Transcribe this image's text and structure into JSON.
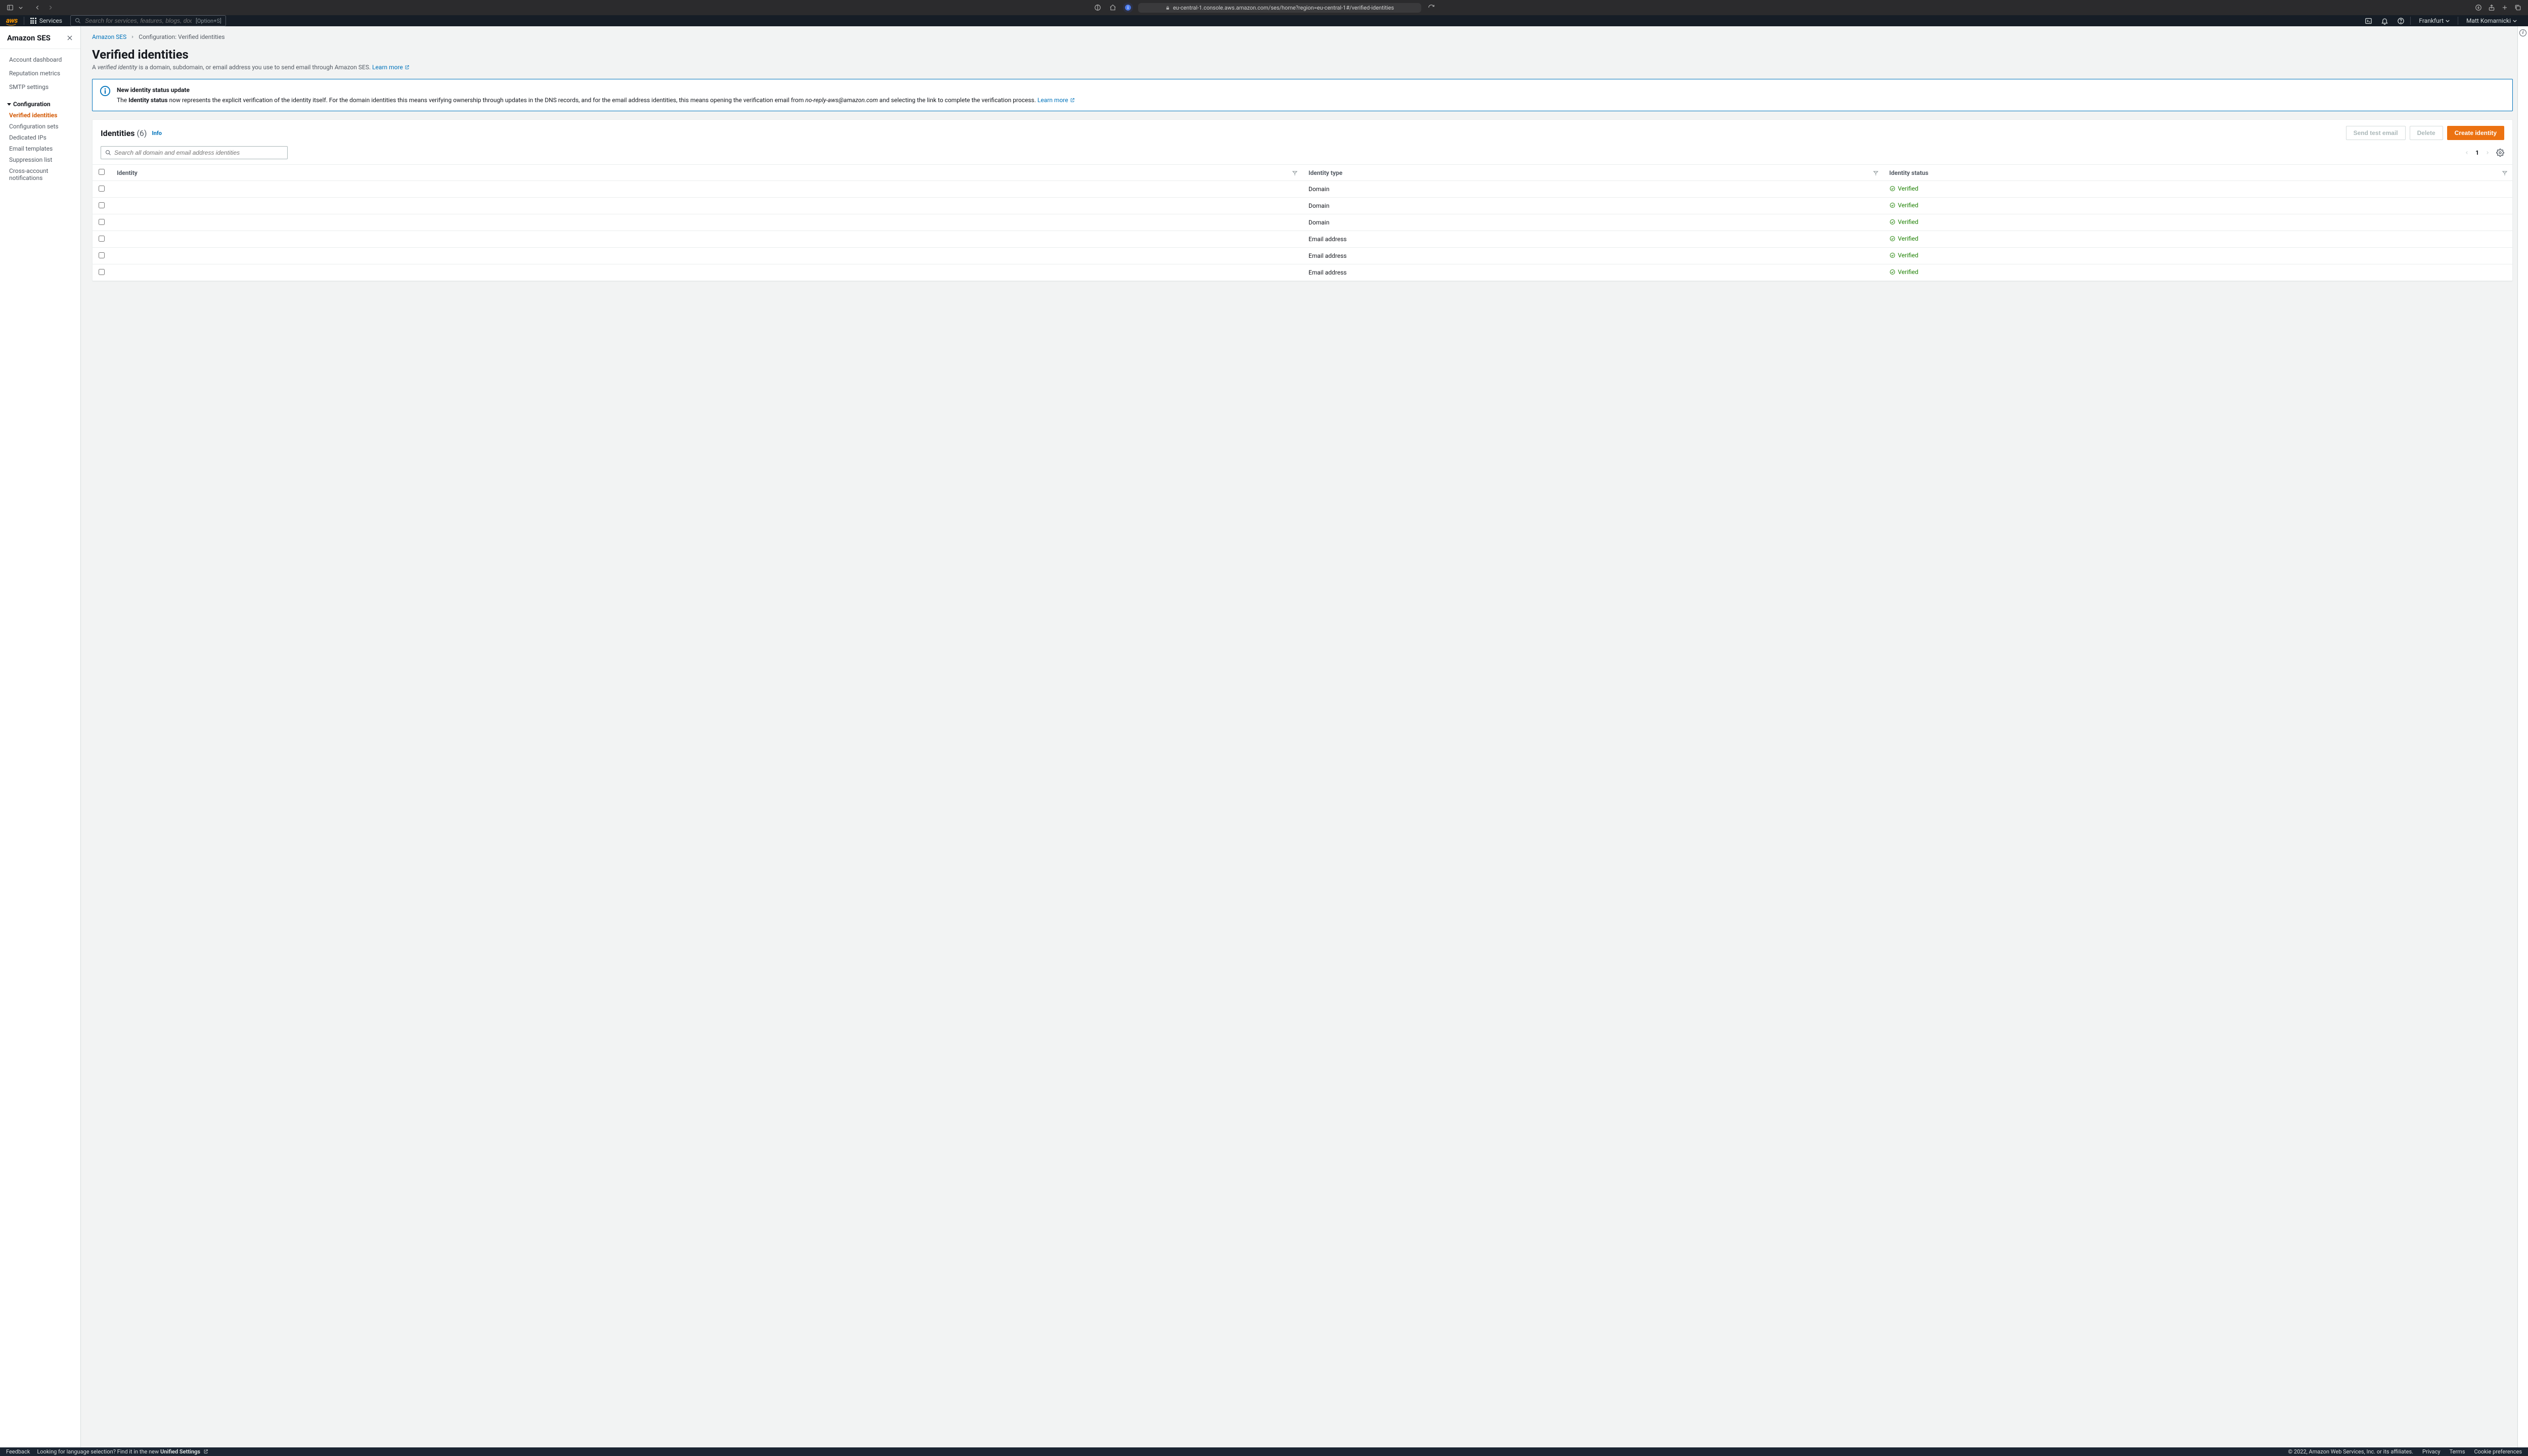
{
  "browser": {
    "url": "eu-central-1.console.aws.amazon.com/ses/home?region=eu-central-1#/verified-identities"
  },
  "topnav": {
    "logo_text": "aws",
    "services_label": "Services",
    "search_placeholder": "Search for services, features, blogs, docs, and more",
    "search_shortcut": "[Option+S]",
    "region_label": "Frankfurt",
    "user_label": "Matt Komarnicki"
  },
  "sidenav": {
    "title": "Amazon SES",
    "items_top": [
      "Account dashboard",
      "Reputation metrics",
      "SMTP settings"
    ],
    "group_label": "Configuration",
    "items_group": [
      "Verified identities",
      "Configuration sets",
      "Dedicated IPs",
      "Email templates",
      "Suppression list",
      "Cross-account notifications"
    ],
    "active_index": 0
  },
  "breadcrumbs": {
    "root": "Amazon SES",
    "current": "Configuration: Verified identities"
  },
  "page": {
    "title": "Verified identities",
    "desc_prefix": "A ",
    "desc_em": "verified identity",
    "desc_suffix": " is a domain, subdomain, or email address you use to send email through Amazon SES. ",
    "learn_more": "Learn more"
  },
  "banner": {
    "title": "New identity status update",
    "p1a": "The ",
    "p1b": "Identity status",
    "p1c": " now represents the explicit verification of the identity itself. For the domain identities this means verifying ownership through updates in the DNS records, and for the email address identities, this means opening the verification email from ",
    "p1d": "no-reply-aws@amazon.com",
    "p1e": " and selecting the link to complete the verification process. ",
    "learn_more": "Learn more"
  },
  "card": {
    "title": "Identities",
    "count_label": "(6)",
    "info_label": "Info",
    "send_test_label": "Send test email",
    "delete_label": "Delete",
    "create_label": "Create identity",
    "search_placeholder": "Search all domain and email address identities",
    "page_number": "1",
    "columns": {
      "identity": "Identity",
      "type": "Identity type",
      "status": "Identity status"
    },
    "rows": [
      {
        "identity": "",
        "type": "Domain",
        "status": "Verified"
      },
      {
        "identity": "",
        "type": "Domain",
        "status": "Verified"
      },
      {
        "identity": "",
        "type": "Domain",
        "status": "Verified"
      },
      {
        "identity": "",
        "type": "Email address",
        "status": "Verified"
      },
      {
        "identity": "",
        "type": "Email address",
        "status": "Verified"
      },
      {
        "identity": "",
        "type": "Email address",
        "status": "Verified"
      }
    ],
    "status_color": "#1d8102"
  },
  "footer": {
    "feedback": "Feedback",
    "lang_prompt": "Looking for language selection? Find it in the new ",
    "unified": "Unified Settings",
    "copyright": "© 2022, Amazon Web Services, Inc. or its affiliates.",
    "privacy": "Privacy",
    "terms": "Terms",
    "cookies": "Cookie preferences"
  }
}
